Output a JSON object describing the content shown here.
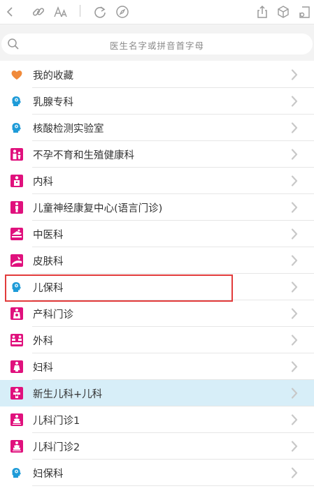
{
  "search": {
    "placeholder": "医生名字或拼音首字母"
  },
  "toolbar": {
    "icons": [
      "back-icon",
      "link-icon",
      "font-size-icon",
      "refresh-icon",
      "compass-icon",
      "share-icon",
      "box-icon",
      "exit-icon"
    ]
  },
  "colors": {
    "heart": "#f08a3a",
    "blue_head": "#1e9bd8",
    "magenta": "#e0117d",
    "selected_row": "#d7eef8",
    "highlight": "#e23b3b"
  },
  "departments": [
    {
      "label": "我的收藏",
      "icon": "heart-icon"
    },
    {
      "label": "乳腺专科",
      "icon": "head-icon"
    },
    {
      "label": "核酸检测实验室",
      "icon": "head-icon"
    },
    {
      "label": "不孕不育和生殖健康科",
      "icon": "fertility-icon"
    },
    {
      "label": "内科",
      "icon": "internal-medicine-icon"
    },
    {
      "label": "儿童神经康复中心(语言门诊)",
      "icon": "child-neuro-icon"
    },
    {
      "label": "中医科",
      "icon": "tcm-icon"
    },
    {
      "label": "皮肤科",
      "icon": "dermatology-icon"
    },
    {
      "label": "儿保科",
      "icon": "head-icon"
    },
    {
      "label": "产科门诊",
      "icon": "obstetrics-icon"
    },
    {
      "label": "外科",
      "icon": "surgery-icon"
    },
    {
      "label": "妇科",
      "icon": "gynecology-icon"
    },
    {
      "label": "新生儿科+儿科",
      "icon": "neonatal-icon"
    },
    {
      "label": "儿科门诊1",
      "icon": "pediatric-icon"
    },
    {
      "label": "儿科门诊2",
      "icon": "pediatric-icon"
    },
    {
      "label": "妇保科",
      "icon": "head-icon"
    }
  ],
  "selected_index": 12,
  "highlighted_index": 8
}
